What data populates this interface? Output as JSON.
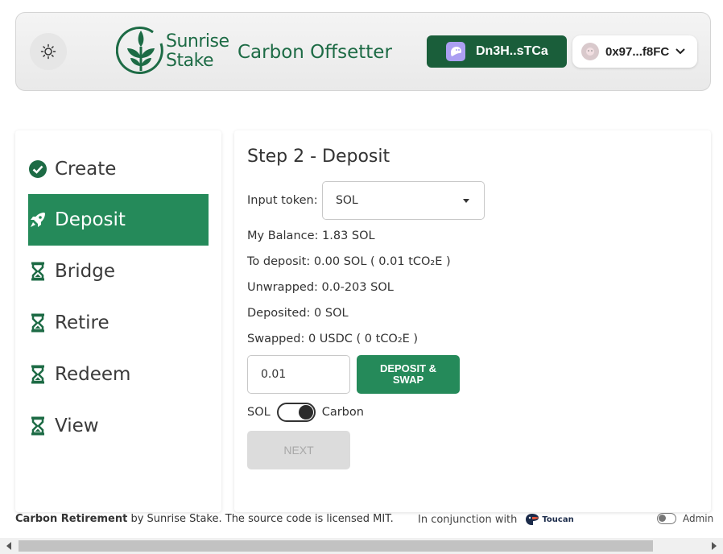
{
  "header": {
    "logo_line1": "Sunrise",
    "logo_line2": "Stake",
    "app_title": "Carbon Offsetter",
    "solana_wallet": "Dn3H..sTCa",
    "eth_wallet": "0x97...f8FC"
  },
  "sidebar": {
    "items": [
      {
        "label": "Create",
        "icon": "check-circle-icon",
        "state": "done"
      },
      {
        "label": "Deposit",
        "icon": "rocket-icon",
        "state": "active"
      },
      {
        "label": "Bridge",
        "icon": "hourglass-icon",
        "state": "pending"
      },
      {
        "label": "Retire",
        "icon": "hourglass-icon",
        "state": "pending"
      },
      {
        "label": "Redeem",
        "icon": "hourglass-icon",
        "state": "pending"
      },
      {
        "label": "View",
        "icon": "hourglass-icon",
        "state": "pending"
      }
    ]
  },
  "main": {
    "step_title": "Step 2 - Deposit",
    "input_token_label": "Input token:",
    "input_token_value": "SOL",
    "my_balance": "My Balance: 1.83 SOL",
    "to_deposit": "To deposit: 0.00 SOL ( 0.01 tCO₂E )",
    "unwrapped": "Unwrapped: 0.0-203 SOL",
    "deposited": "Deposited: 0 SOL",
    "swapped": "Swapped: 0 USDC ( 0 tCO₂E )",
    "amount_value": "0.01",
    "deposit_button": "DEPOSIT & SWAP",
    "toggle_left": "SOL",
    "toggle_right": "Carbon",
    "next_button": "NEXT"
  },
  "footer": {
    "brand": "Carbon Retirement",
    "text": " by Sunrise Stake. The source code is licensed MIT.",
    "conjunction": "In conjunction with",
    "partner": "Toucan",
    "admin_label": "Admin"
  },
  "colors": {
    "brand_green": "#1a5e3a",
    "accent_green": "#258a5a",
    "phantom_purple": "#ab9ff2"
  }
}
